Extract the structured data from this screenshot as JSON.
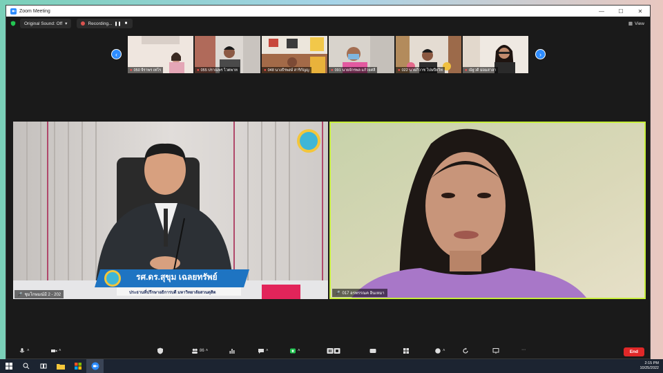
{
  "window": {
    "title": "Zoom Meeting"
  },
  "topbar": {
    "audio_label": "Original Sound: Off",
    "recording_label": "Recording...",
    "view_label": "View"
  },
  "gallery": [
    {
      "name": "050 จีราพร เทโร"
    },
    {
      "name": "055 ปราณพร ไวตพาท"
    },
    {
      "name": "048 นางธีรพงษ์ สาริกัญญ"
    },
    {
      "name": "091 นายจักรพล แก้วยศลี"
    },
    {
      "name": "022 นายภิวาช โปษปียวิท"
    },
    {
      "name": "ณัฐวดี ม่อมสาลา"
    }
  ],
  "main": {
    "left": {
      "name_plate": "รศ.ดร.สุขุม เฉลยทรัพย์",
      "name_subtitle": "ประธานที่ปรึกษาอธิการบดี มหาวิทยาลัยสวนดุสิต",
      "caption": "ชุมโกษมณ์มี 2 - 202"
    },
    "right": {
      "caption": "017 อรพรรณค อินเหมา"
    }
  },
  "toolbar": {
    "participant_count": "86",
    "end_label": "End"
  },
  "taskbar": {
    "time": "2:15 PM",
    "date": "10/25/2022"
  },
  "colors": {
    "accent": "#2d8cff",
    "active_speaker": "#c7ef3a",
    "end": "#e02828"
  }
}
